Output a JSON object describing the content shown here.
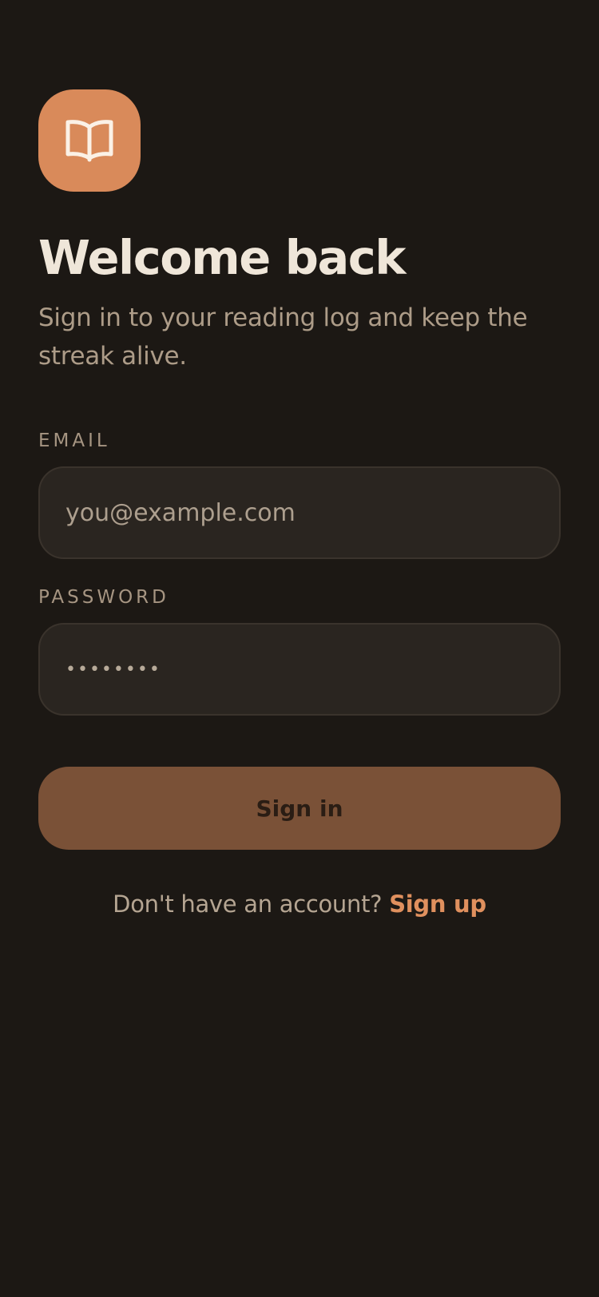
{
  "brand": {
    "logo_icon": "open-book-icon",
    "logo_color": "#d98a5a"
  },
  "header": {
    "title": "Welcome back",
    "subtitle": "Sign in to your reading log and keep the streak alive."
  },
  "form": {
    "email": {
      "label": "EMAIL",
      "placeholder": "you@example.com",
      "value": ""
    },
    "password": {
      "label": "PASSWORD",
      "value": "••••••••"
    },
    "submit_label": "Sign in"
  },
  "footer": {
    "prompt": "Don't have an account?",
    "link_label": "Sign up"
  },
  "colors": {
    "background": "#1c1814",
    "accent": "#e0905e",
    "button": "#7a5137",
    "title": "#efe6d9",
    "muted": "#ad9c88"
  }
}
